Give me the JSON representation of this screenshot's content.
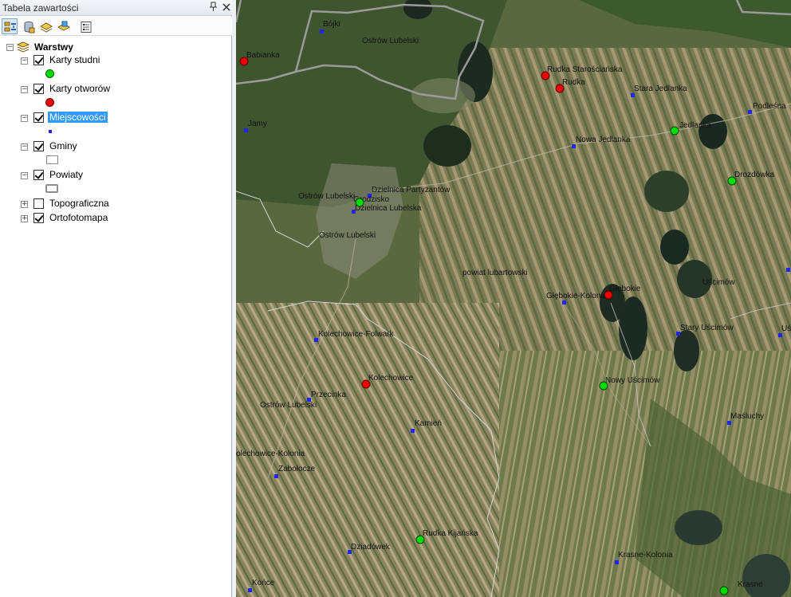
{
  "toc": {
    "title": "Tabela zawartości",
    "pin_glyph": "ᵖ",
    "close_glyph": "✕",
    "toolbar": [
      {
        "name": "list-by-drawing-order-icon",
        "active": true
      },
      {
        "name": "list-by-source-icon",
        "active": false
      },
      {
        "name": "list-by-visibility-icon",
        "active": false
      },
      {
        "name": "list-by-selection-icon",
        "active": false
      },
      {
        "name": "options-icon",
        "active": false
      }
    ],
    "root_label": "Warstwy",
    "layers": {
      "karty_studni": "Karty studni",
      "karty_otworow": "Karty otworów",
      "miejscowosci": "Miejscowości",
      "gminy": "Gminy",
      "powiaty": "Powiaty",
      "topograficzna": "Topograficzna",
      "ortofotomapa": "Ortofotomapa"
    },
    "expander_minus": "−",
    "expander_plus": "+"
  },
  "map": {
    "towns": [
      {
        "label": "Bójki"
      },
      {
        "label": "Ostrów Lubelski"
      },
      {
        "label": "Babianka"
      },
      {
        "label": "Rudka Starościańska"
      },
      {
        "label": "Rudka"
      },
      {
        "label": "Stara Jedlanka"
      },
      {
        "label": "Podleśna"
      },
      {
        "label": "Jamy"
      },
      {
        "label": "Jedlanka"
      },
      {
        "label": "Nowa Jedlanka"
      },
      {
        "label": "Drozdówka"
      },
      {
        "label": "Dzielnica Partyzantów"
      },
      {
        "label": "Ostrów Lubelski"
      },
      {
        "label": "Grodzisko"
      },
      {
        "label": "Dzielnica Lubelska"
      },
      {
        "label": "Ostrów Lubelski"
      },
      {
        "label": "powiat lubartowski"
      },
      {
        "label": "Głębokie"
      },
      {
        "label": "Głębokie-Kolonia"
      },
      {
        "label": "Uścimów"
      },
      {
        "label": "Stary Uścimów"
      },
      {
        "label": "Kolechowice-Folwark"
      },
      {
        "label": "Kolechowice"
      },
      {
        "label": "Nowy Uścimów"
      },
      {
        "label": "Przecinka"
      },
      {
        "label": "Ostrów Lubelski"
      },
      {
        "label": "Kamień"
      },
      {
        "label": "Maśluchy"
      },
      {
        "label": "olechowice-Kolonia"
      },
      {
        "label": "Zabołocze"
      },
      {
        "label": "Rudka Kijańska"
      },
      {
        "label": "Dziadówek"
      },
      {
        "label": "Krasne-Kolonia"
      },
      {
        "label": "Krasne"
      },
      {
        "label": "Końce"
      },
      {
        "label": "Uś"
      }
    ],
    "colors": {
      "well": "#00dd00",
      "borehole": "#ee0000",
      "town": "#2222ff",
      "gmina_border": "#d6d6d6",
      "powiat_border": "#9a9a9a"
    }
  }
}
